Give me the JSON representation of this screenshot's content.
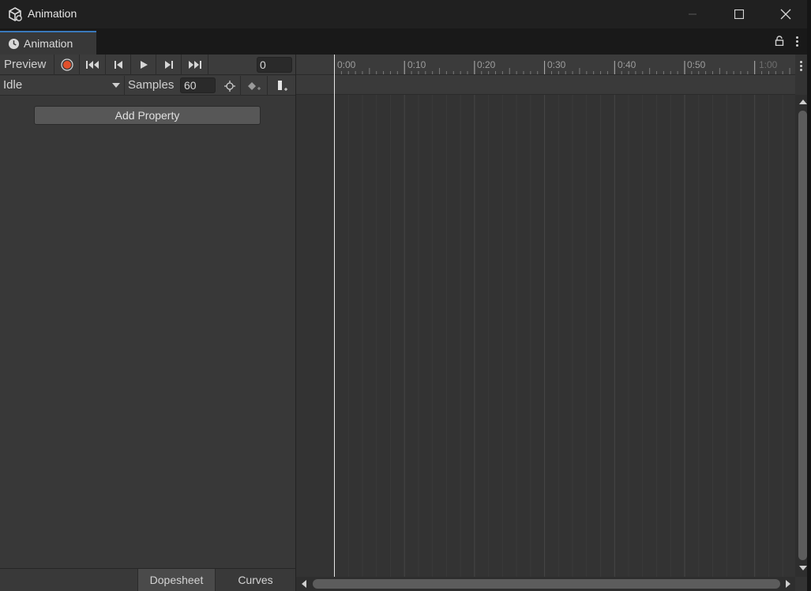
{
  "window": {
    "title": "Animation",
    "icon": "unity-cube-icon",
    "controls": [
      "minimize-icon",
      "maximize-icon",
      "close-icon"
    ]
  },
  "tab": {
    "label": "Animation",
    "icon": "clock-icon",
    "accent": "#3a79bb"
  },
  "toolbar": {
    "preview_label": "Preview",
    "record_color": "#e0502c",
    "buttons": [
      "record-icon",
      "first-key-icon",
      "prev-key-icon",
      "play-icon",
      "next-key-icon",
      "last-key-icon"
    ],
    "frame_value": "0"
  },
  "clip": {
    "selected": "Idle",
    "samples_label": "Samples",
    "samples_value": "60",
    "tools": [
      "filter-by-selection-icon",
      "add-keyframe-icon",
      "add-event-icon"
    ]
  },
  "properties": {
    "add_property_label": "Add Property"
  },
  "view_tabs": {
    "dopesheet": "Dopesheet",
    "curves": "Curves",
    "active": "dopesheet"
  },
  "timeline": {
    "ticks": [
      "0:00",
      "0:10",
      "0:20",
      "0:30",
      "0:40",
      "0:50",
      "1:00"
    ],
    "playhead": "0:00"
  }
}
